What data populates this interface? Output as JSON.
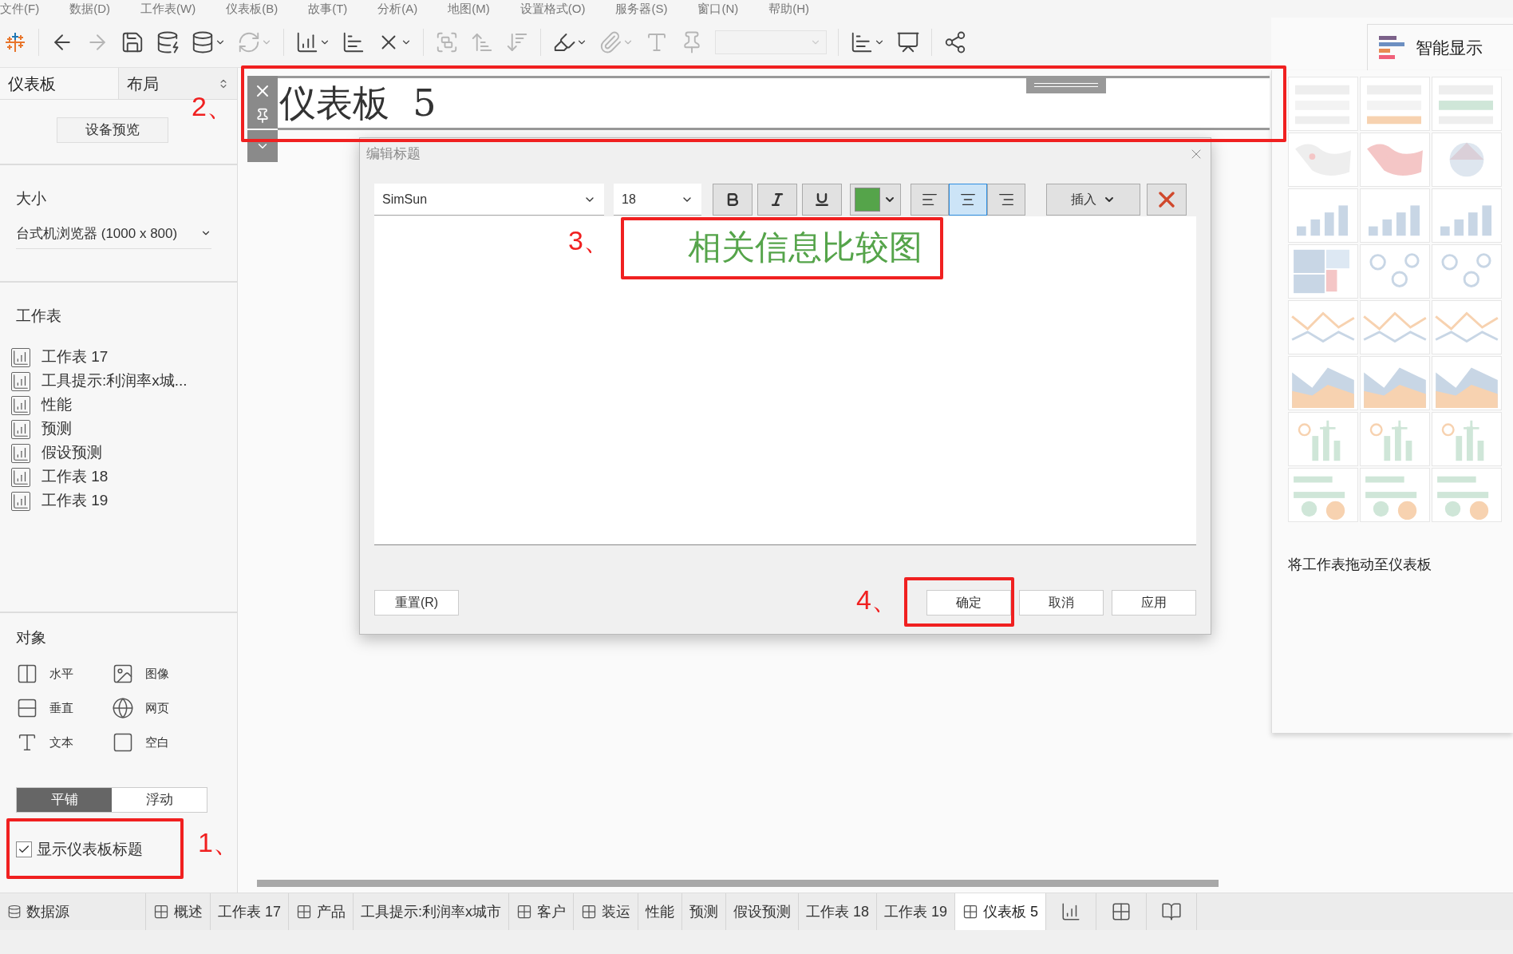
{
  "menu_bar": [
    "文件(F)",
    "数据(D)",
    "工作表(W)",
    "仪表板(B)",
    "故事(T)",
    "分析(A)",
    "地图(M)",
    "设置格式(O)",
    "服务器(S)",
    "窗口(N)",
    "帮助(H)"
  ],
  "left_panel": {
    "tabs": [
      {
        "label": "仪表板",
        "selected": true
      },
      {
        "label": "布局",
        "selected": false
      }
    ],
    "device_preview_button": "设备预览",
    "size": {
      "heading": "大小",
      "value": "台式机浏览器 (1000 x 800)"
    },
    "worksheets": {
      "heading": "工作表",
      "items": [
        "工作表 17",
        "工具提示:利润率x城...",
        "性能",
        "预测",
        "假设预测",
        "工作表 18",
        "工作表 19"
      ]
    },
    "objects": {
      "heading": "对象",
      "items": [
        {
          "kind": "horizontal",
          "label": "水平"
        },
        {
          "kind": "image",
          "label": "图像"
        },
        {
          "kind": "vertical",
          "label": "垂直"
        },
        {
          "kind": "webpage",
          "label": "网页"
        },
        {
          "kind": "text",
          "label": "文本"
        },
        {
          "kind": "blank",
          "label": "空白"
        }
      ]
    },
    "layout_mode": [
      {
        "label": "平铺",
        "selected": true
      },
      {
        "label": "浮动",
        "selected": false
      }
    ],
    "show_title": {
      "label": "显示仪表板标题",
      "checked": true
    }
  },
  "dashboard_title": "仪表板  5",
  "dialog": {
    "title": "编辑标题",
    "font": "SimSun",
    "size": "18",
    "color_picker": {
      "color": "#55a44a"
    },
    "alignment": [
      {
        "kind": "left",
        "selected": false
      },
      {
        "kind": "center",
        "selected": true
      },
      {
        "kind": "right",
        "selected": false
      }
    ],
    "insert_button": "插入",
    "text": "相关信息比较图",
    "buttons": [
      "重置(R)",
      "确定",
      "取消",
      "应用"
    ]
  },
  "show_me": {
    "title": "智能显示",
    "hint": "将工作表拖动至仪表板"
  },
  "sheet_tabs": [
    {
      "kind": "datasource",
      "label": "数据源",
      "selected": false
    },
    {
      "kind": "dashboard",
      "label": "概述",
      "selected": false
    },
    {
      "kind": "worksheet",
      "label": "工作表 17",
      "selected": false
    },
    {
      "kind": "dashboard",
      "label": "产品",
      "selected": false
    },
    {
      "kind": "worksheet",
      "label": "工具提示:利润率x城市",
      "selected": false
    },
    {
      "kind": "dashboard",
      "label": "客户",
      "selected": false
    },
    {
      "kind": "dashboard",
      "label": "装运",
      "selected": false
    },
    {
      "kind": "worksheet",
      "label": "性能",
      "selected": false
    },
    {
      "kind": "worksheet",
      "label": "预测",
      "selected": false
    },
    {
      "kind": "worksheet",
      "label": "假设预测",
      "selected": false
    },
    {
      "kind": "worksheet",
      "label": "工作表 18",
      "selected": false
    },
    {
      "kind": "worksheet",
      "label": "工作表 19",
      "selected": false
    },
    {
      "kind": "dashboard",
      "label": "仪表板 5",
      "selected": true
    }
  ],
  "annotations": [
    "1、",
    "2、",
    "3、",
    "4、"
  ]
}
